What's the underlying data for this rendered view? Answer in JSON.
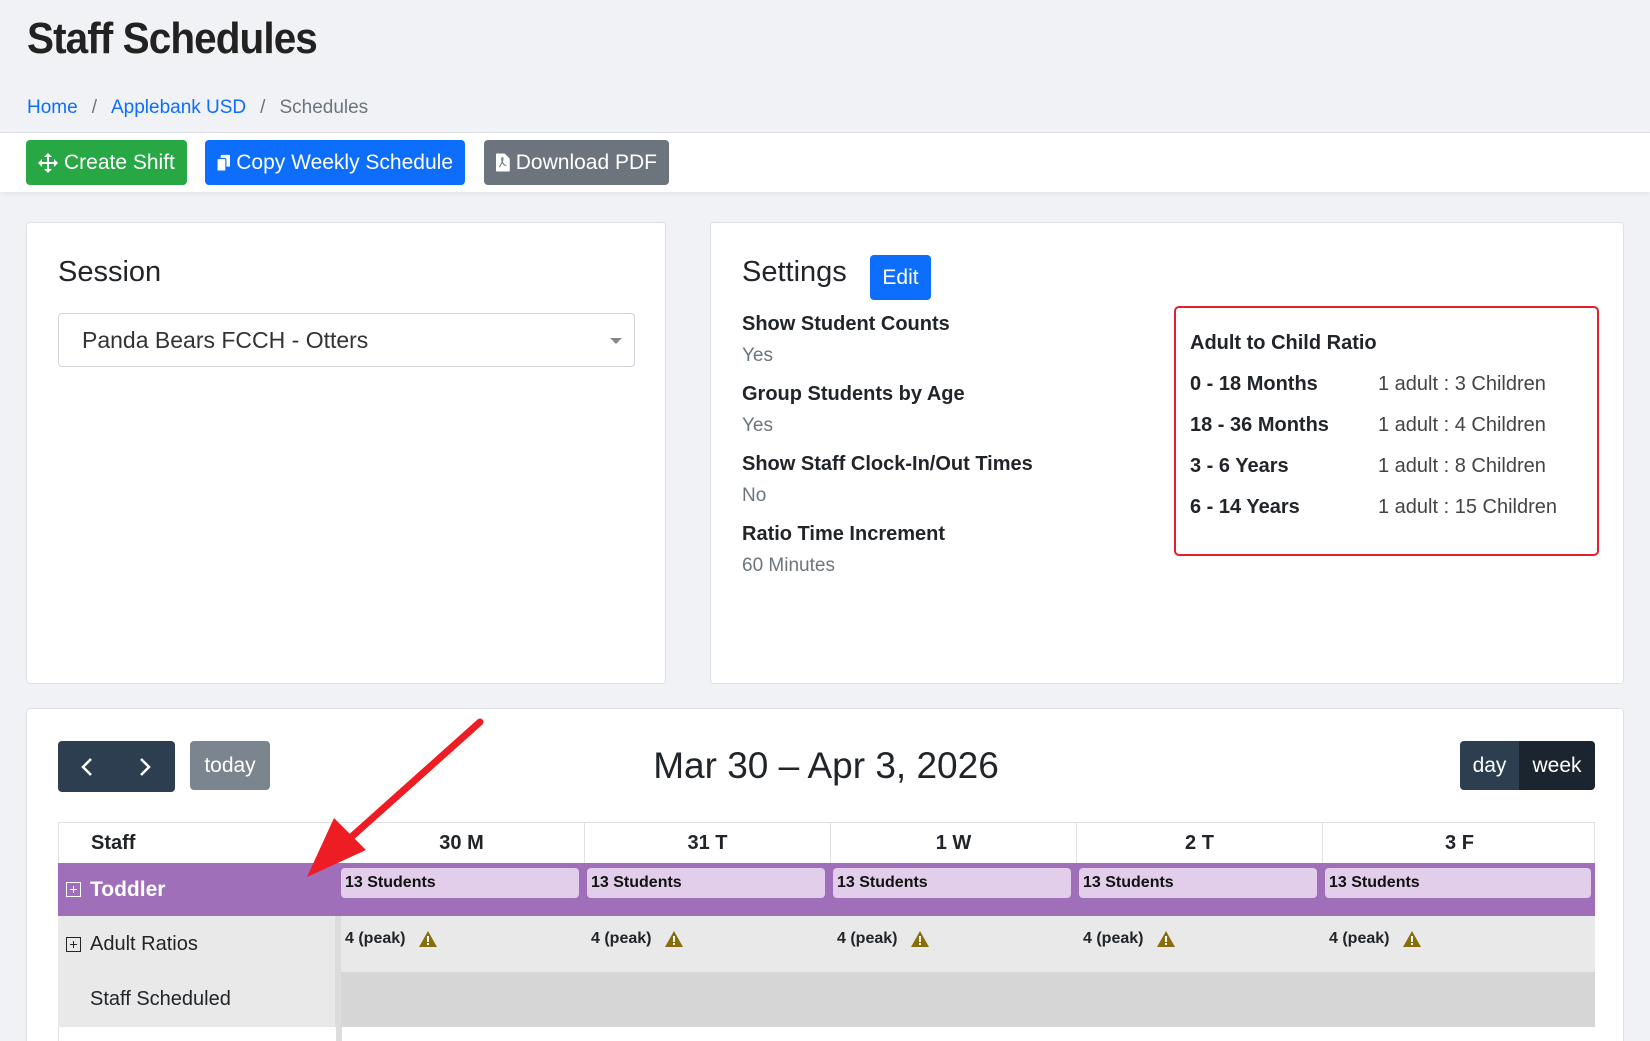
{
  "page": {
    "title": "Staff Schedules",
    "breadcrumb": [
      "Home",
      "Applebank USD",
      "Schedules"
    ]
  },
  "toolbar": {
    "create_shift": "Create Shift",
    "copy_weekly": "Copy Weekly Schedule",
    "download_pdf": "Download PDF"
  },
  "session": {
    "title": "Session",
    "selected": "Panda Bears FCCH - Otters"
  },
  "settings": {
    "title": "Settings",
    "edit_label": "Edit",
    "items": [
      {
        "label": "Show Student Counts",
        "value": "Yes"
      },
      {
        "label": "Group Students by Age",
        "value": "Yes"
      },
      {
        "label": "Show Staff Clock-In/Out Times",
        "value": "No"
      },
      {
        "label": "Ratio Time Increment",
        "value": "60 Minutes"
      }
    ],
    "ratio": {
      "title": "Adult to Child Ratio",
      "rows": [
        {
          "age": "0 - 18 Months",
          "ratio": "1 adult : 3 Children"
        },
        {
          "age": "18 - 36 Months",
          "ratio": "1 adult : 4 Children"
        },
        {
          "age": "3 - 6 Years",
          "ratio": "1 adult : 8 Children"
        },
        {
          "age": "6 - 14 Years",
          "ratio": "1 adult : 15 Children"
        }
      ]
    }
  },
  "calendar": {
    "today_label": "today",
    "title": "Mar 30 – Apr 3, 2026",
    "view_day": "day",
    "view_week": "week",
    "staff_header": "Staff",
    "days": [
      "30 M",
      "31 T",
      "1 W",
      "2 T",
      "3 F"
    ],
    "group_label": "Toddler",
    "group_counts": [
      "13 Students",
      "13 Students",
      "13 Students",
      "13 Students",
      "13 Students"
    ],
    "ratio_label": "Adult Ratios",
    "ratio_values": [
      "4 (peak)",
      "4 (peak)",
      "4 (peak)",
      "4 (peak)",
      "4 (peak)"
    ],
    "staff_label": "Staff Scheduled"
  },
  "colors": {
    "accent": "#0d6efd",
    "success": "#28a745",
    "secondary": "#6c757d",
    "group": "#a06fb9",
    "highlight": "#e0202c",
    "warning": "#8a6d0b"
  }
}
